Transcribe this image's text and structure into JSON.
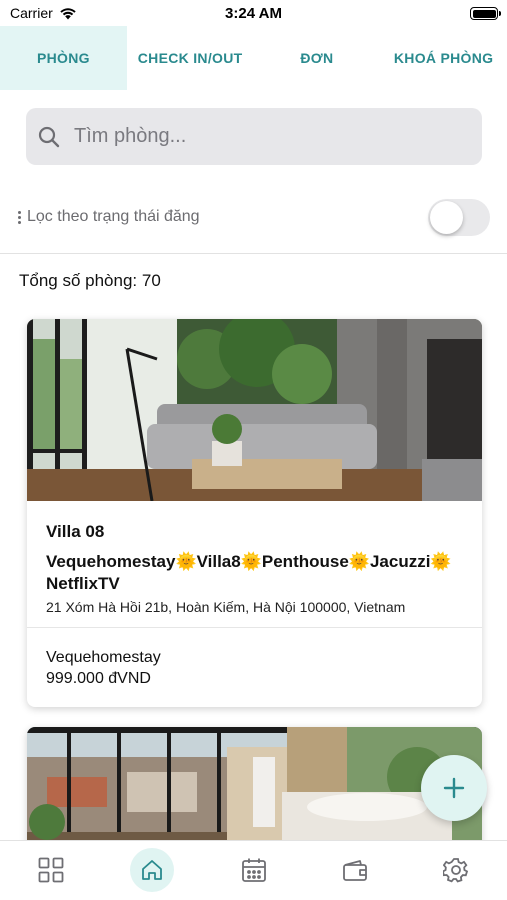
{
  "status_bar": {
    "carrier": "Carrier",
    "time": "3:24 AM"
  },
  "tabs": [
    {
      "label": "PHÒNG",
      "active": true
    },
    {
      "label": "CHECK IN/OUT",
      "active": false
    },
    {
      "label": "ĐƠN",
      "active": false
    },
    {
      "label": "KHOÁ PHÒNG",
      "active": false
    }
  ],
  "search": {
    "placeholder": "Tìm phòng...",
    "value": ""
  },
  "filter": {
    "label": "Lọc theo trạng thái đăng",
    "toggle_on": false
  },
  "summary": {
    "total_rooms": "Tổng số phòng: 70"
  },
  "rooms": [
    {
      "name": "Villa 08",
      "title": "Vequehomestay🌞Villa8🌞Penthouse🌞Jacuzzi🌞NetflixTV",
      "address": "21 Xóm Hà Hồi 21b, Hoàn Kiếm, Hà Nội 100000, Vietnam",
      "host": "Vequehomestay",
      "price": "999.000 đVND"
    }
  ],
  "bottom_nav": [
    {
      "icon": "grid-icon",
      "active": false
    },
    {
      "icon": "home-icon",
      "active": true
    },
    {
      "icon": "calendar-icon",
      "active": false
    },
    {
      "icon": "wallet-icon",
      "active": false
    },
    {
      "icon": "gear-icon",
      "active": false
    }
  ],
  "colors": {
    "accent": "#2a8a8e",
    "accent_light": "#e0f4f2",
    "search_bg": "#e7e7ea"
  }
}
